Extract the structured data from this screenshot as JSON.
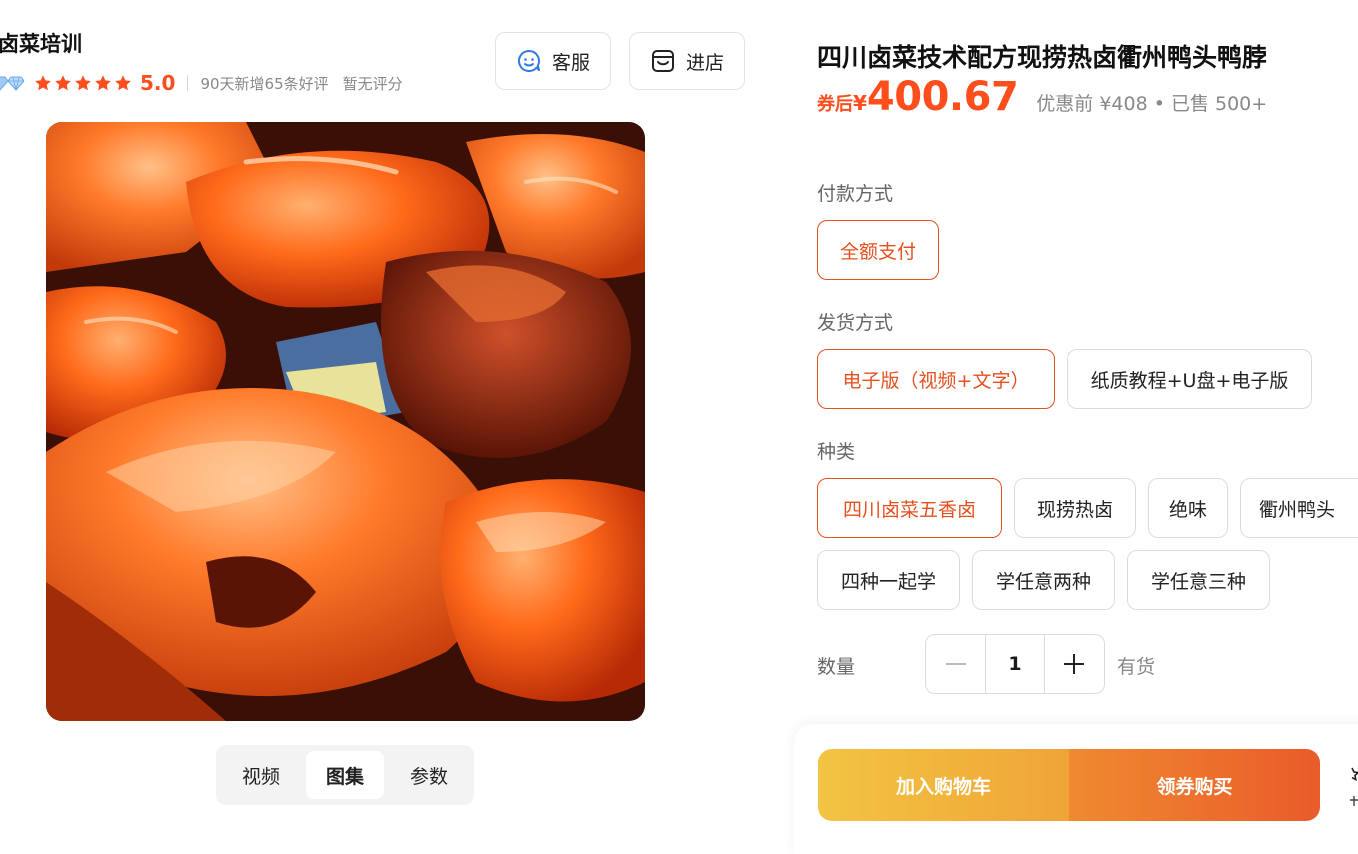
{
  "shop": {
    "name": "卤菜培训",
    "score": "5.0",
    "new_reviews": "90天新增65条好评",
    "no_rating": "暂无评分",
    "service_label": "客服",
    "store_label": "进店"
  },
  "media": {
    "tabs": [
      "视频",
      "图集",
      "参数"
    ],
    "active_tab": "图集"
  },
  "product": {
    "title": "四川卤菜技术配方现捞热卤衢州鸭头鸭脖",
    "coupon_label": "券后",
    "currency": "¥",
    "price": "400.67",
    "original_and_sold": "优惠前 ¥408 • 已售 500+"
  },
  "options": {
    "payment": {
      "label": "付款方式",
      "items": [
        "全额支付"
      ],
      "selected": "全额支付"
    },
    "delivery": {
      "label": "发货方式",
      "items": [
        "电子版（视频+文字）",
        "纸质教程+U盘+电子版"
      ],
      "selected": "电子版（视频+文字）"
    },
    "category": {
      "label": "种类",
      "items": [
        "四川卤菜五香卤",
        "现捞热卤",
        "绝味",
        "衢州鸭头",
        "四种一起学",
        "学任意两种",
        "学任意三种"
      ],
      "selected": "四川卤菜五香卤"
    }
  },
  "quantity": {
    "label": "数量",
    "value": "1",
    "stock": "有货"
  },
  "actions": {
    "add_to_cart": "加入购物车",
    "coupon_buy": "领券购买"
  },
  "colors": {
    "accent": "#e5501f",
    "price": "#ff4d1c",
    "cart_gradient": [
      "#f2c443",
      "#f0a437"
    ],
    "buy_gradient": [
      "#ef8a30",
      "#ea5b2a"
    ]
  }
}
